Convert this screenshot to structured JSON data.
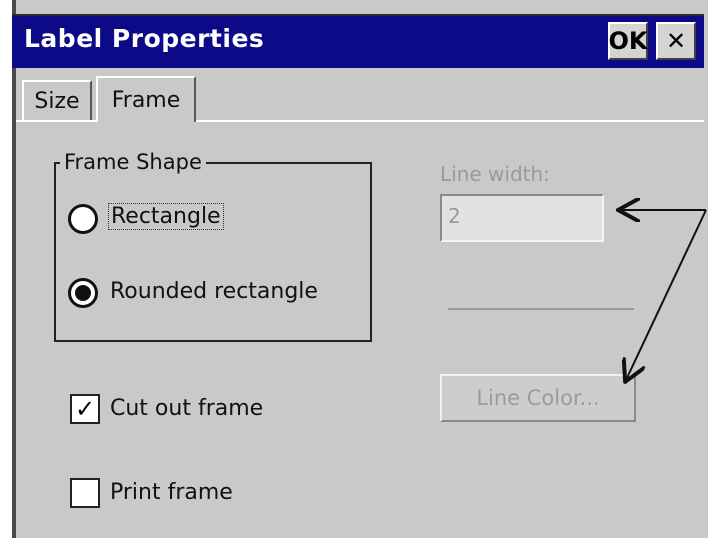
{
  "window": {
    "title": "Label Properties",
    "ok_label": "OK",
    "close_glyph": "✕"
  },
  "tabs": [
    {
      "label": "Size"
    },
    {
      "label": "Frame",
      "active": true
    }
  ],
  "frame_shape": {
    "legend": "Frame Shape",
    "options": [
      {
        "label": "Rectangle",
        "selected": false
      },
      {
        "label": "Rounded rectangle",
        "selected": true
      }
    ]
  },
  "checkboxes": [
    {
      "label": "Cut out frame",
      "checked": true,
      "glyph": "✓"
    },
    {
      "label": "Print frame",
      "checked": false
    }
  ],
  "line_width": {
    "label": "Line width:",
    "value": "2",
    "disabled": true
  },
  "line_color_button": {
    "label": "Line Color...",
    "disabled": true
  },
  "colors": {
    "titlebar": "#0c0a86",
    "dialog_bg": "#c9c9c9",
    "disabled_text": "#9a9a9a"
  }
}
